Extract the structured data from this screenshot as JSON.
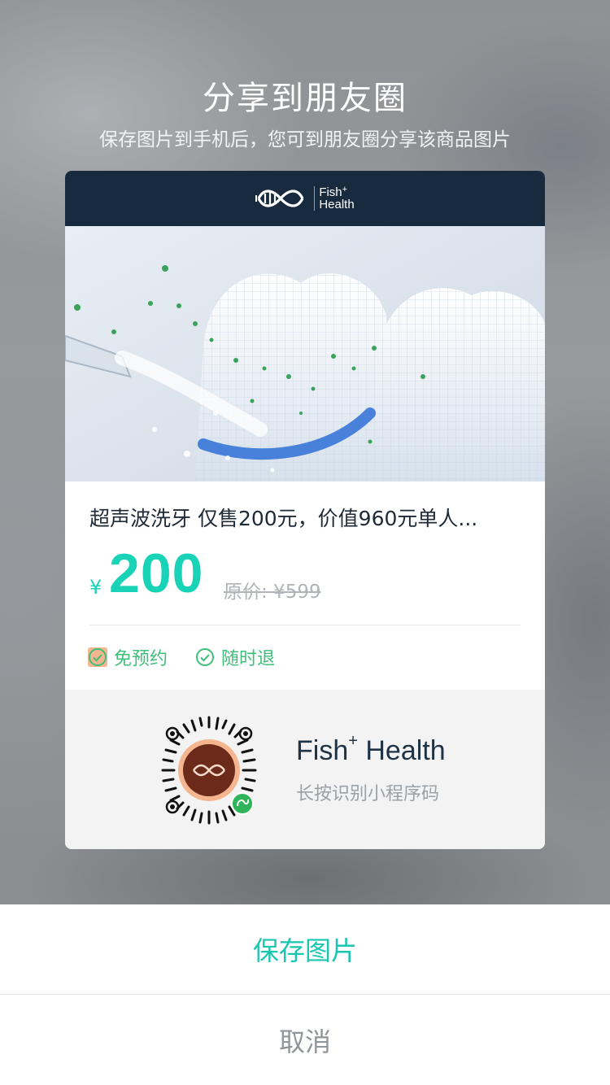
{
  "share": {
    "title": "分享到朋友圈",
    "subtitle": "保存图片到手机后，您可到朋友圈分享该商品图片"
  },
  "brand": {
    "name_line1": "Fish",
    "name_sup": "+",
    "name_line2": "Health"
  },
  "product": {
    "title": "超声波洗牙 仅售200元，价值960元单人...",
    "currency": "¥",
    "price": "200",
    "original_price": "原价: ¥599",
    "tags": [
      {
        "label": "免预约",
        "icon": "check-circle-icon"
      },
      {
        "label": "随时退",
        "icon": "check-circle-icon"
      }
    ]
  },
  "footer": {
    "name": "Fish",
    "name_plus": "+",
    "name_rest": " Health",
    "hint": "长按识别小程序码"
  },
  "actions": {
    "save_label": "保存图片",
    "cancel_label": "取消"
  },
  "colors": {
    "accent": "#19d3b6",
    "brand_bar": "#172a3e",
    "tag_green": "#3fbf7a"
  }
}
